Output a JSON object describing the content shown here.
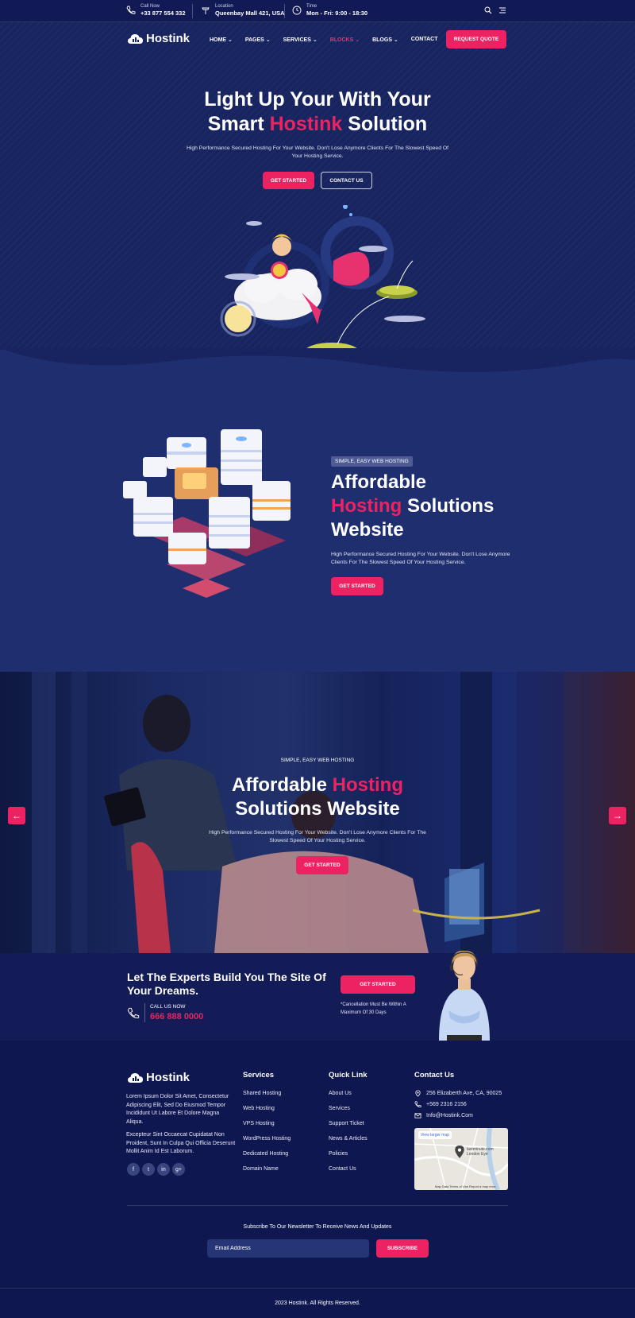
{
  "topbar": {
    "call_label": "Call Now",
    "call_value": "+33 877 554 332",
    "location_label": "Location",
    "location_value": "Queenbay Mall 421, USA",
    "time_label": "Time",
    "time_value": "Mon - Fri: 9:00 - 18:30"
  },
  "brand": {
    "name": "Hostink"
  },
  "nav": {
    "items": [
      "HOME",
      "PAGES",
      "SERVICES",
      "BLOCKS",
      "BLOGS",
      "CONTACT"
    ],
    "cta": "REQUEST QUOTE"
  },
  "hero": {
    "title_line1": "Light Up Your With Your",
    "title_line2_pre": "Smart ",
    "title_line2_highlight": "Hostink",
    "title_line2_post": " Solution",
    "subtitle": "High Performance Secured Hosting For Your Website. Don't Lose Anymore Clients For The Slowest Speed Of Your Hosting Service.",
    "btn_primary": "GET STARTED",
    "btn_secondary": "CONTACT US"
  },
  "feature": {
    "badge": "SIMPLE, EASY WEB HOSTING",
    "title_line1": "Affordable",
    "title_line2_highlight": "Hosting",
    "title_line2_post": " Solutions",
    "title_line3": "Website",
    "subtitle": "High Performance Secured Hosting For Your Website. Don't Lose Anymore Clients For The Slowest Speed Of Your Hosting Service.",
    "btn": "GET STARTED"
  },
  "slider": {
    "badge": "SIMPLE, EASY WEB HOSTING",
    "title_line1_pre": "Affordable ",
    "title_line1_highlight": "Hosting",
    "title_line2": "Solutions Website",
    "subtitle": "High Performance Secured Hosting For Your Website. Don't Lose Anymore Clients For The Slowest Speed Of Your Hosting Service.",
    "btn": "GET STARTED",
    "prev": "←",
    "next": "→"
  },
  "cta": {
    "title": "Let The Experts Build You The Site Of Your Dreams.",
    "call_label": "CALL US NOW",
    "phone": "666 888 0000",
    "btn": "GET STARTED",
    "note": "*Cancellation Must Be Within A Maximum Of 30 Days"
  },
  "footer": {
    "about_1": "Lorem Ipsum Dolor Sit Amet, Consectetur Adipiscing Elit, Sed Do Eiusmod Tempor Incididunt Ut Labore Et Dolore Magna Aliqua.",
    "about_2": "Excepteur Sint Occaecat Cupidatat Non Proident, Sunt In Culpa Qui Officia Deserunt Mollit Anim Id Est Laborum.",
    "social": [
      "f",
      "t",
      "in",
      "g+"
    ],
    "services_title": "Services",
    "services": [
      "Shared Hosting",
      "Web Hosting",
      "VPS Hosting",
      "WordPress Hosting",
      "Dedicated Hosting",
      "Domain Name"
    ],
    "quick_title": "Quick Link",
    "quick": [
      "About Us",
      "Services",
      "Support Ticket",
      "News & Articles",
      "Policies",
      "Contact Us"
    ],
    "contact_title": "Contact Us",
    "address": "256 Elizaberth Ave, CA, 90025",
    "phone": "+569 2316 2156",
    "email": "Info@Hostink.Com",
    "map_label": "View larger map",
    "map_place": "lastminute.com London Eye",
    "map_footer": "Map Data  Terms of Use  Report a map error",
    "newsletter_text": "Subscribe To Our Newsletter To Receive News And Updates",
    "email_placeholder": "Email Address",
    "subscribe": "SUBSCRIBE",
    "copyright": "2023 Hostink. All Rights Reserved."
  },
  "colors": {
    "accent": "#ec2263",
    "navy": "#17245f",
    "footer": "#0f1750"
  }
}
